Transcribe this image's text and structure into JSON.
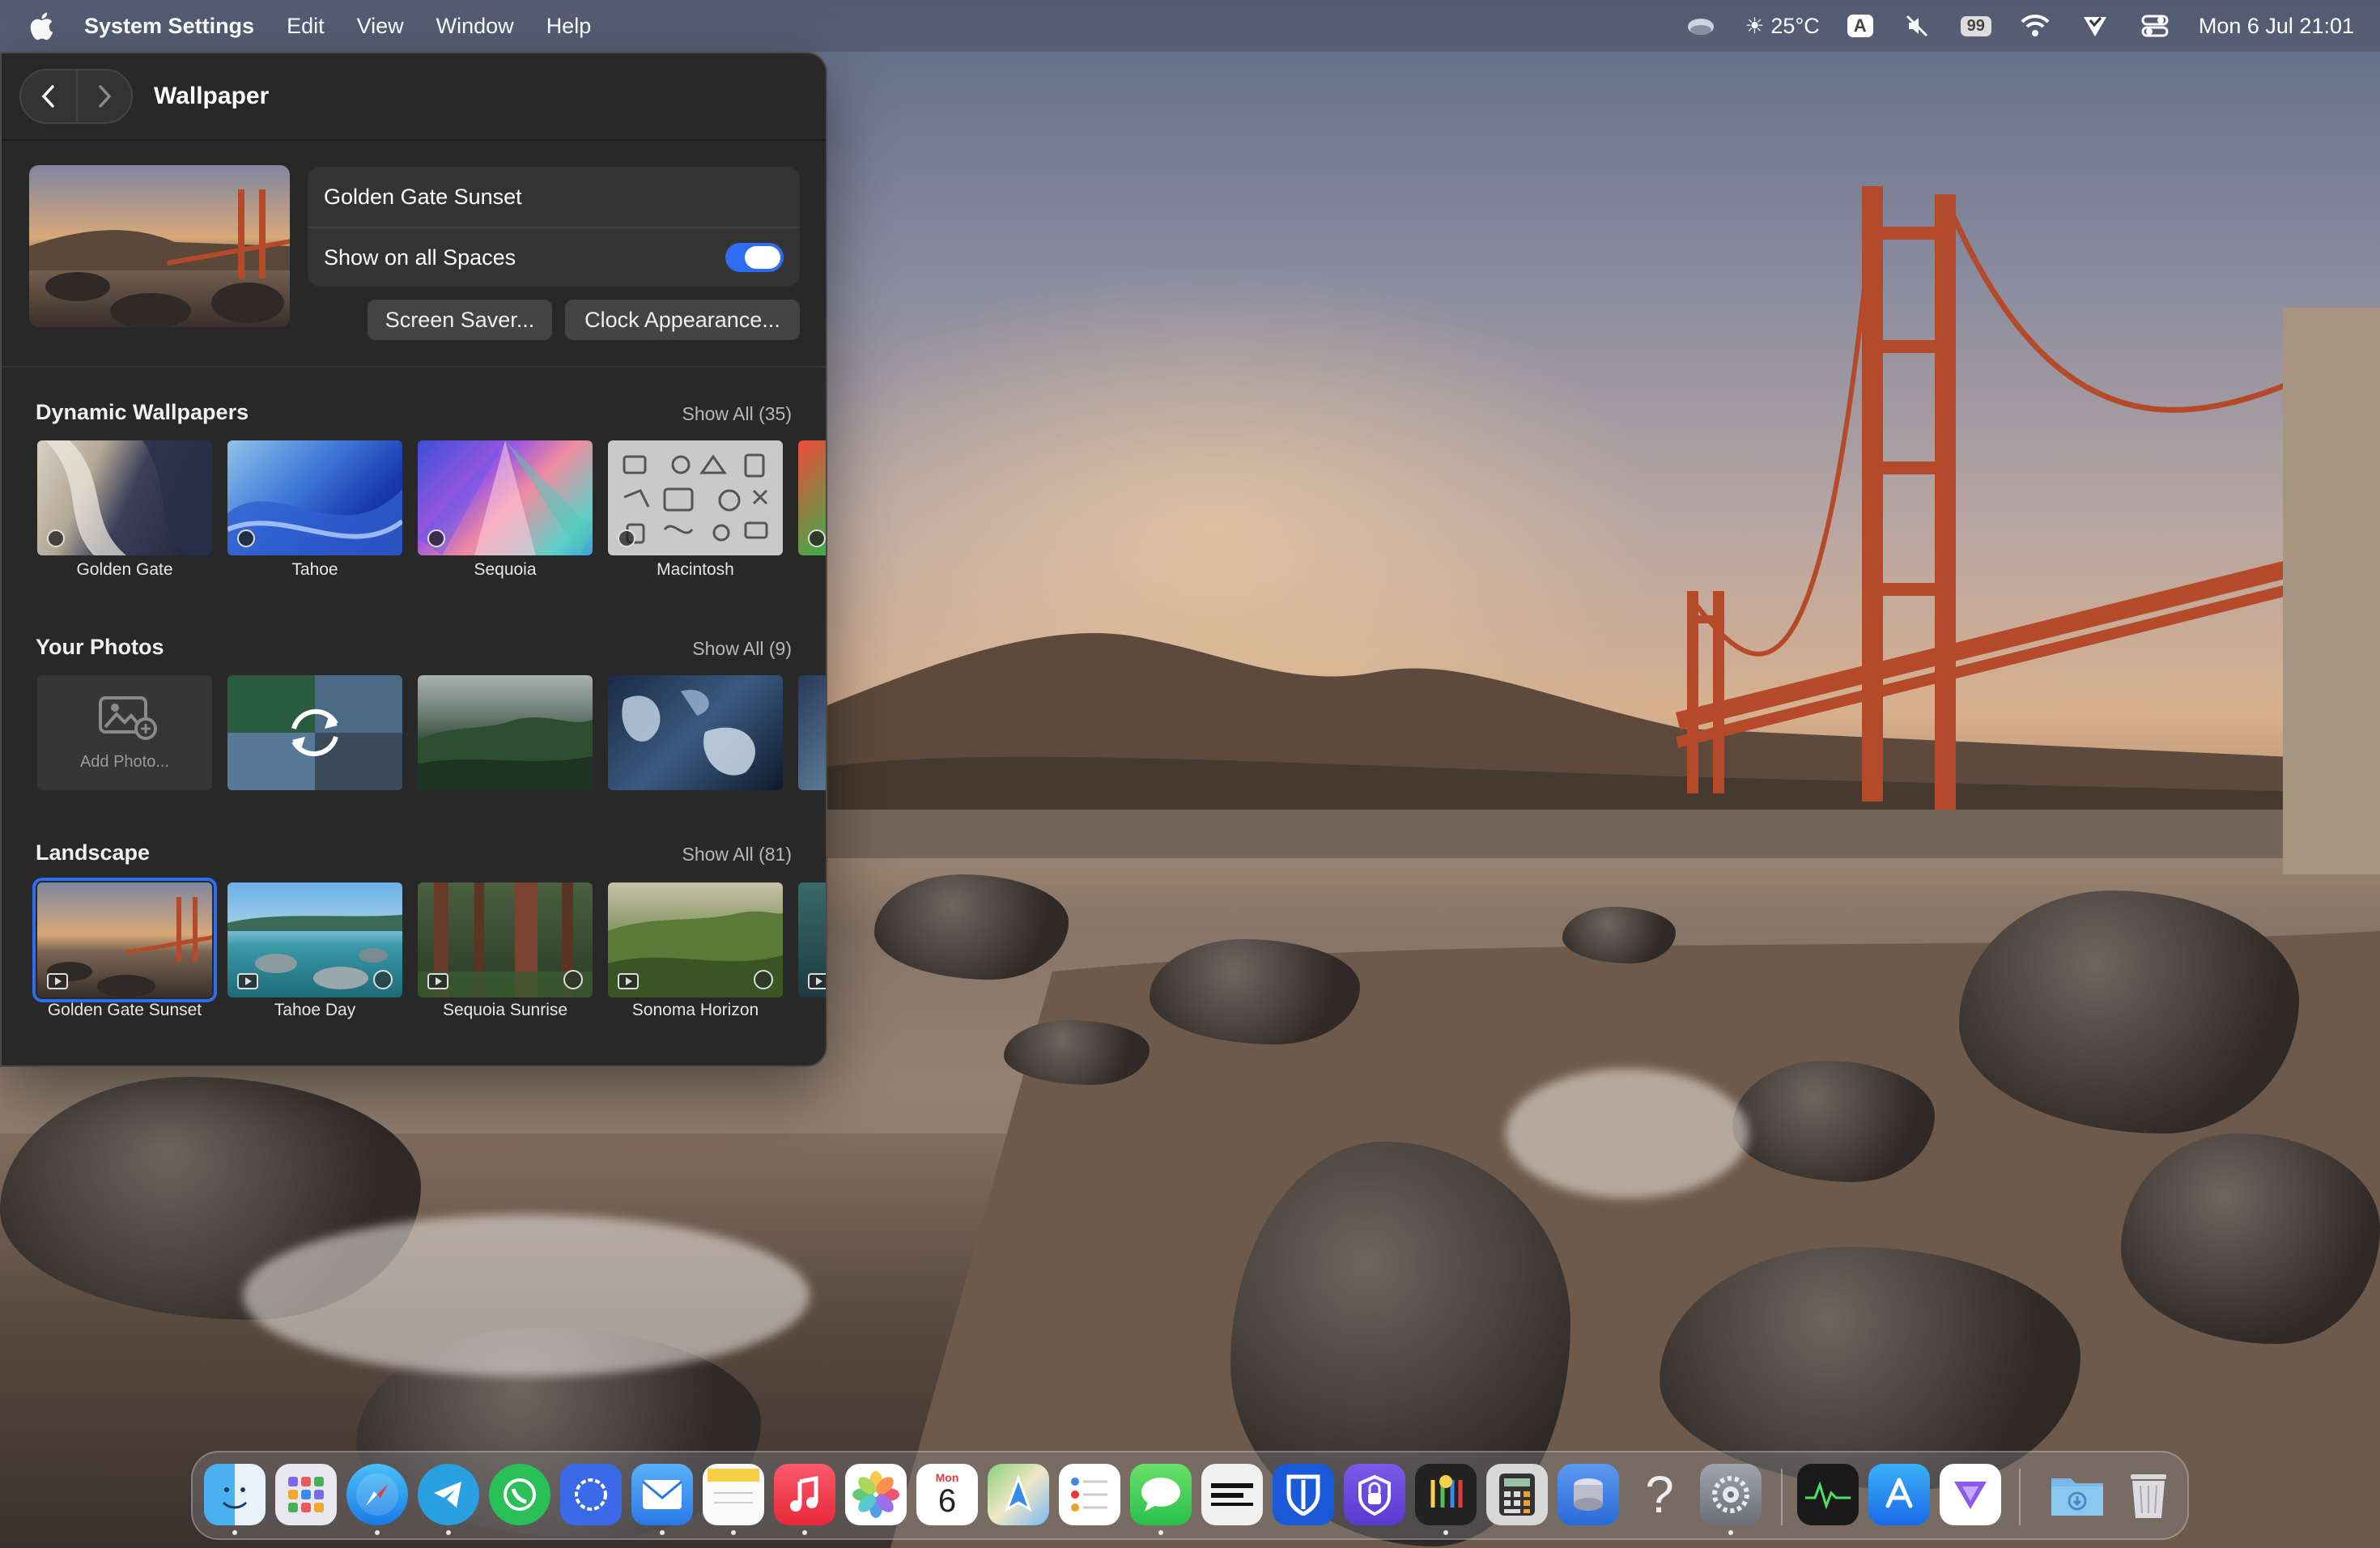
{
  "menubar": {
    "app_name": "System Settings",
    "menus": [
      "Edit",
      "View",
      "Window",
      "Help"
    ],
    "weather": "25°C",
    "input_source": "A",
    "battery": "99",
    "datetime": "Mon 6 Jul  21:01"
  },
  "window": {
    "title": "Wallpaper",
    "current_wallpaper_name": "Golden Gate Sunset",
    "show_on_all_spaces_label": "Show on all Spaces",
    "show_on_all_spaces": true,
    "screen_saver_button": "Screen Saver...",
    "clock_appearance_button": "Clock Appearance..."
  },
  "sections": {
    "dynamic": {
      "title": "Dynamic Wallpapers",
      "show_all": "Show All (35)",
      "items": [
        "Golden Gate",
        "Tahoe",
        "Sequoia",
        "Macintosh"
      ]
    },
    "photos": {
      "title": "Your Photos",
      "show_all": "Show All (9)",
      "add_label": "Add Photo..."
    },
    "landscape": {
      "title": "Landscape",
      "show_all": "Show All (81)",
      "items": [
        "Golden Gate Sunset",
        "Tahoe Day",
        "Sequoia Sunrise",
        "Sonoma Horizon"
      ]
    }
  },
  "dock": {
    "calendar_month": "Mon",
    "calendar_day": "6",
    "apps": [
      "finder",
      "launchpad",
      "safari",
      "telegram",
      "whatsapp",
      "signal",
      "mail",
      "notes",
      "music",
      "photos",
      "calendar",
      "maps",
      "reminders",
      "messages",
      "terminal",
      "bitwarden",
      "vpn",
      "keychain",
      "calculator",
      "disk-utility",
      "help",
      "system-settings",
      "activity-monitor",
      "app-store",
      "proton",
      "downloads",
      "trash"
    ]
  },
  "colors": {
    "accent": "#2f6df0",
    "window_bg": "#282828"
  }
}
